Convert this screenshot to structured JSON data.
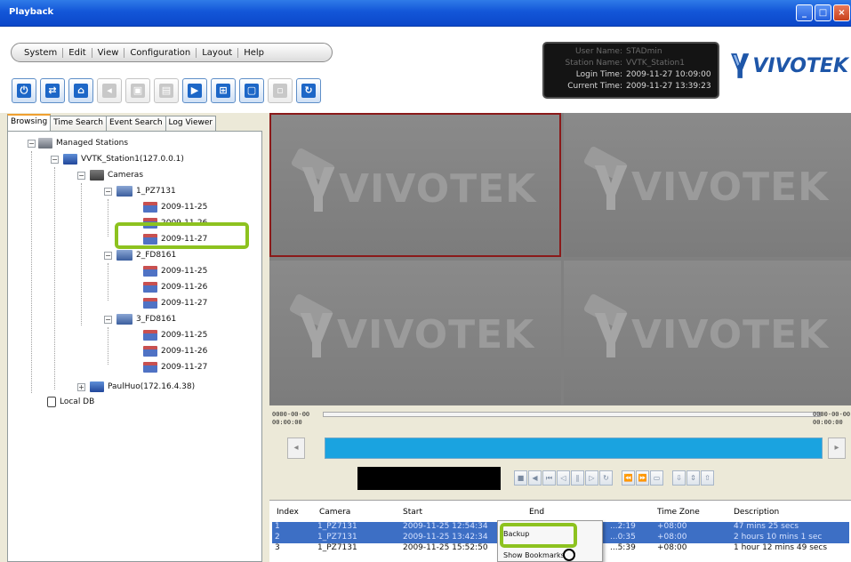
{
  "window": {
    "title": "Playback",
    "buttons": [
      "minimize",
      "maximize",
      "close"
    ]
  },
  "menu": [
    "System",
    "Edit",
    "View",
    "Configuration",
    "Layout",
    "Help"
  ],
  "toolbar": [
    {
      "icon": "power-icon",
      "enabled": true
    },
    {
      "icon": "stations-icon",
      "enabled": true
    },
    {
      "icon": "lock-icon",
      "enabled": true
    },
    {
      "icon": "speaker-icon",
      "enabled": false
    },
    {
      "icon": "snapshot-icon",
      "enabled": false
    },
    {
      "icon": "print-icon",
      "enabled": false
    },
    {
      "icon": "export-icon",
      "enabled": true
    },
    {
      "icon": "layout-grid-icon",
      "enabled": true
    },
    {
      "icon": "fullscreen-icon",
      "enabled": true
    },
    {
      "icon": "disabled-tool-icon",
      "enabled": false
    },
    {
      "icon": "refresh-icon",
      "enabled": true
    }
  ],
  "info": {
    "user_label": "User Name:",
    "user_value": "STADmin",
    "station_label": "Station Name:",
    "station_value": "VVTK_Station1",
    "login_label": "Login Time:",
    "login_value": "2009-11-27 10:09:00",
    "current_label": "Current Time:",
    "current_value": "2009-11-27 13:39:23"
  },
  "logo": {
    "text": "VIVOTEK",
    "color": "#1e56a8"
  },
  "tabs": [
    "Browsing",
    "Time Search",
    "Event Search",
    "Log Viewer"
  ],
  "tree": {
    "root": "Managed Stations",
    "station": "VVTK_Station1(127.0.0.1)",
    "cameras_folder": "Cameras",
    "cameras": [
      {
        "name": "1_PZ7131",
        "dates": [
          "2009-11-25",
          "2009-11-26",
          "2009-11-27"
        ]
      },
      {
        "name": "2_FD8161",
        "dates": [
          "2009-11-25",
          "2009-11-26",
          "2009-11-27"
        ]
      },
      {
        "name": "3_FD8161",
        "dates": [
          "2009-11-25",
          "2009-11-26",
          "2009-11-27"
        ]
      }
    ],
    "other_station": "PaulHuo(172.16.4.38)",
    "local_db": "Local DB",
    "highlight_color": "#8dc21f"
  },
  "video": {
    "watermark": "VIVOTEK",
    "selected_border_color": "#8b1a1a"
  },
  "timeline": {
    "start_date": "0000-00-00",
    "start_time": "00:00:00",
    "end_date": "0000-00-00",
    "end_time": "00:00:00",
    "bar_color": "#1aa3e0"
  },
  "events": {
    "columns": [
      "Index",
      "Camera",
      "Start",
      "End",
      "Time Zone",
      "Description"
    ],
    "rows": [
      {
        "index": "1",
        "camera": "1_PZ7131",
        "start": "2009-11-25 12:54:34",
        "end": "...2:19",
        "tz": "+08:00",
        "desc": "47 mins 25 secs",
        "selected": true
      },
      {
        "index": "2",
        "camera": "1_PZ7131",
        "start": "2009-11-25 13:42:34",
        "end": "...0:35",
        "tz": "+08:00",
        "desc": "2 hours 10 mins 1 sec",
        "selected": true
      },
      {
        "index": "3",
        "camera": "1_PZ7131",
        "start": "2009-11-25 15:52:50",
        "end": "...5:39",
        "tz": "+08:00",
        "desc": "1 hour 12 mins 49 secs",
        "selected": false
      }
    ],
    "selected_color": "#3d6fc5"
  },
  "context_menu": {
    "items": [
      "Backup",
      "Show Bookmarks"
    ]
  }
}
